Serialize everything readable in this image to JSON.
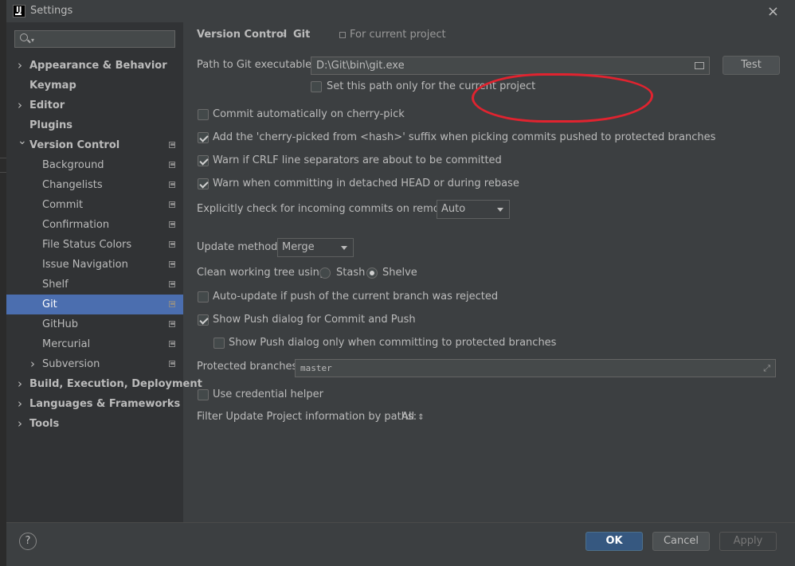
{
  "window": {
    "title": "Settings",
    "icon": "intellij-idea-icon",
    "close": "×"
  },
  "sidebar": {
    "search_icon": "search-icon",
    "items": [
      {
        "label": "Appearance & Behavior",
        "expandable": true,
        "expanded": false
      },
      {
        "label": "Keymap"
      },
      {
        "label": "Editor",
        "expandable": true,
        "expanded": false
      },
      {
        "label": "Plugins"
      },
      {
        "label": "Version Control",
        "expandable": true,
        "expanded": true,
        "project": true
      },
      {
        "label": "Background",
        "project": true
      },
      {
        "label": "Changelists",
        "project": true
      },
      {
        "label": "Commit",
        "project": true
      },
      {
        "label": "Confirmation",
        "project": true
      },
      {
        "label": "File Status Colors",
        "project": true
      },
      {
        "label": "Issue Navigation",
        "project": true
      },
      {
        "label": "Shelf",
        "project": true
      },
      {
        "label": "Git",
        "project": true,
        "selected": true
      },
      {
        "label": "GitHub",
        "project": true
      },
      {
        "label": "Mercurial",
        "project": true
      },
      {
        "label": "Subversion",
        "expandable": true,
        "project": true
      },
      {
        "label": "Build, Execution, Deployment",
        "expandable": true
      },
      {
        "label": "Languages & Frameworks",
        "expandable": true
      },
      {
        "label": "Tools",
        "expandable": true
      }
    ]
  },
  "breadcrumb": {
    "parent": "Version Control",
    "sep": "›",
    "current": "Git",
    "scope": "For current project"
  },
  "git": {
    "path_label": "Path to Git executable:",
    "path_value": "D:\\Git\\bin\\git.exe",
    "test_button": "Test",
    "set_path_project": {
      "label": "Set this path only for the current project",
      "checked": false
    },
    "commit_auto_cherry": {
      "label": "Commit automatically on cherry-pick",
      "checked": false
    },
    "add_cherry_suffix": {
      "label": "Add the 'cherry-picked from <hash>' suffix when picking commits pushed to protected branches",
      "checked": true
    },
    "warn_crlf": {
      "label": "Warn if CRLF line separators are about to be committed",
      "checked": true
    },
    "warn_detached": {
      "label": "Warn when committing in detached HEAD or during rebase",
      "checked": true
    },
    "incoming_label": "Explicitly check for incoming commits on remotes:",
    "incoming_value": "Auto",
    "update_label": "Update method:",
    "update_value": "Merge",
    "clean_label": "Clean working tree using:",
    "stash_label": "Stash",
    "shelve_label": "Shelve",
    "clean_selected": "Shelve",
    "auto_update": {
      "label": "Auto-update if push of the current branch was rejected",
      "checked": false
    },
    "show_push": {
      "label": "Show Push dialog for Commit and Push",
      "checked": true
    },
    "show_push_protected": {
      "label": "Show Push dialog only when committing to protected branches",
      "checked": false
    },
    "protected_label": "Protected branches:",
    "protected_value": "master",
    "credential_helper": {
      "label": "Use credential helper",
      "checked": false
    },
    "filter_label": "Filter Update Project information by paths:",
    "filter_value": "All",
    "filter_arrows": "⇕"
  },
  "footer": {
    "help": "?",
    "ok": "OK",
    "cancel": "Cancel",
    "apply": "Apply"
  },
  "colors": {
    "selection": "#4b6eaf",
    "primary_button": "#365880",
    "annotation": "#e1232f"
  }
}
